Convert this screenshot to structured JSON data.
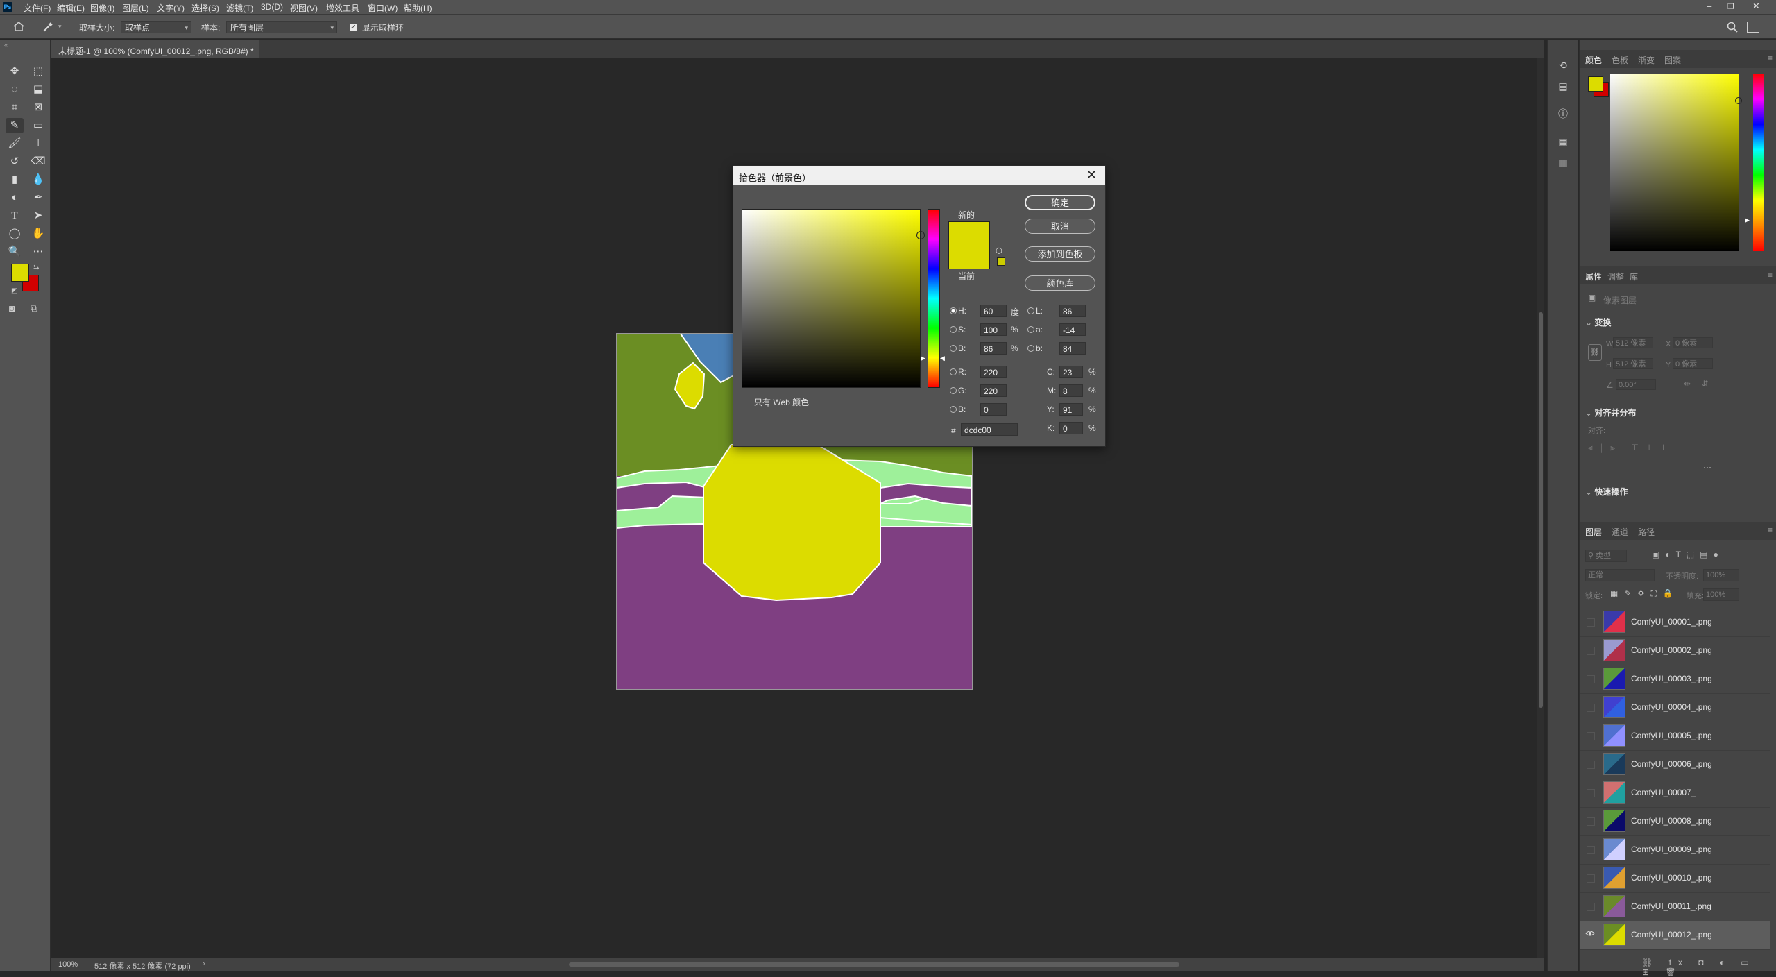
{
  "app": {
    "logo": "Ps"
  },
  "menubar": {
    "items": [
      "文件(F)",
      "编辑(E)",
      "图像(I)",
      "图层(L)",
      "文字(Y)",
      "选择(S)",
      "滤镜(T)",
      "3D(D)",
      "视图(V)",
      "增效工具",
      "窗口(W)",
      "帮助(H)"
    ],
    "win_min": "–",
    "win_restore": "❐",
    "win_close": "✕"
  },
  "options": {
    "sample_size_label": "取样大小:",
    "sample_size_value": "取样点",
    "sample_label": "样本:",
    "sample_value": "所有图层",
    "show_ring_label": "显示取样环",
    "show_ring_checked": true
  },
  "document": {
    "tab_title": "未标题-1 @ 100% (ComfyUI_00012_.png, RGB/8#) *",
    "tab_close": "×",
    "zoom": "100%",
    "status": "512 像素 x 512 像素 (72 ppi)",
    "status_arrow": "›"
  },
  "colors": {
    "foreground": "#dcdc00",
    "background": "#d10000",
    "seg_olive": "#6b8e23",
    "seg_purple": "#7f3f82",
    "seg_mint": "#9ef09a",
    "seg_blue": "#4a7fb5",
    "seg_yellow": "#dcdc00"
  },
  "toolbar": {
    "icons": [
      "move-icon",
      "marquee-icon",
      "lasso-icon",
      "object-select-icon",
      "crop-icon",
      "frame-icon",
      "eyedropper-icon",
      "patch-icon",
      "brush-icon",
      "stamp-icon",
      "history-brush-icon",
      "eraser-icon",
      "gradient-icon",
      "blur-icon",
      "dodge-icon",
      "pen-icon",
      "type-icon",
      "path-select-icon",
      "ellipse-icon",
      "hand-icon",
      "zoom-icon",
      "more-icon"
    ]
  },
  "color_picker": {
    "title": "拾色器（前景色）",
    "close": "✕",
    "new_label": "新的",
    "current_label": "当前",
    "ok": "确定",
    "cancel": "取消",
    "add_swatch": "添加到色板",
    "color_libraries": "颜色库",
    "web_only_label": "只有 Web 颜色",
    "hue_degrees": 60,
    "fields": {
      "H": {
        "label": "H:",
        "value": "60",
        "unit": "度"
      },
      "S": {
        "label": "S:",
        "value": "100",
        "unit": "%"
      },
      "B": {
        "label": "B:",
        "value": "86",
        "unit": "%"
      },
      "R": {
        "label": "R:",
        "value": "220"
      },
      "G": {
        "label": "G:",
        "value": "220"
      },
      "Bl": {
        "label": "B:",
        "value": "0"
      },
      "L": {
        "label": "L:",
        "value": "86"
      },
      "a": {
        "label": "a:",
        "value": "-14"
      },
      "b": {
        "label": "b:",
        "value": "84"
      },
      "C": {
        "label": "C:",
        "value": "23",
        "unit": "%"
      },
      "M": {
        "label": "M:",
        "value": "8",
        "unit": "%"
      },
      "Y": {
        "label": "Y:",
        "value": "91",
        "unit": "%"
      },
      "K": {
        "label": "K:",
        "value": "0",
        "unit": "%"
      }
    },
    "hex_label": "#",
    "hex_value": "dcdc00"
  },
  "color_panel": {
    "tabs": [
      "颜色",
      "色板",
      "渐变",
      "图案"
    ]
  },
  "properties_panel": {
    "tabs": [
      "属性",
      "调整",
      "库"
    ],
    "pixel_layer": "像素图层",
    "transform": "变换",
    "w_label": "W",
    "w_value": "512 像素",
    "h_label": "H",
    "h_value": "512 像素",
    "x_label": "X",
    "x_value": "0 像素",
    "y_label": "Y",
    "y_value": "0 像素",
    "angle_value": "0.00°",
    "align": "对齐并分布",
    "align_sub": "对齐:",
    "quick": "快速操作",
    "more": "···"
  },
  "layers_panel": {
    "tabs": [
      "图层",
      "通道",
      "路径"
    ],
    "search_placeholder": "类型",
    "blend_mode": "正常",
    "opacity_label": "不透明度:",
    "opacity_value": "100%",
    "lock_label": "锁定:",
    "fill_label": "填充:",
    "fill_value": "100%",
    "layers": [
      {
        "name": "ComfyUI_00001_.png",
        "thumb": [
          "#3a3aaa",
          "#e0304a"
        ],
        "visible": false,
        "selected": false
      },
      {
        "name": "ComfyUI_00002_.png",
        "thumb": [
          "#9a9ad0",
          "#b0304a"
        ],
        "visible": false,
        "selected": false
      },
      {
        "name": "ComfyUI_00003_.png",
        "thumb": [
          "#5a9a3a",
          "#1a1ab0"
        ],
        "visible": false,
        "selected": false
      },
      {
        "name": "ComfyUI_00004_.png",
        "thumb": [
          "#4040d0",
          "#3060e0"
        ],
        "visible": false,
        "selected": false
      },
      {
        "name": "ComfyUI_00005_.png",
        "thumb": [
          "#5070d0",
          "#9090ff"
        ],
        "visible": false,
        "selected": false
      },
      {
        "name": "ComfyUI_00006_.png",
        "thumb": [
          "#2a6a8a",
          "#1a3a5a"
        ],
        "visible": false,
        "selected": false
      },
      {
        "name": "ComfyUI_00007_",
        "thumb": [
          "#d07070",
          "#20a0a0"
        ],
        "visible": false,
        "selected": false
      },
      {
        "name": "ComfyUI_00008_.png",
        "thumb": [
          "#5a9a3a",
          "#0a0a6a"
        ],
        "visible": false,
        "selected": false
      },
      {
        "name": "ComfyUI_00009_.png",
        "thumb": [
          "#6a8ad0",
          "#d0d0ff"
        ],
        "visible": false,
        "selected": false
      },
      {
        "name": "ComfyUI_00010_.png",
        "thumb": [
          "#3a5ab0",
          "#e0a030"
        ],
        "visible": false,
        "selected": false
      },
      {
        "name": "ComfyUI_00011_.png",
        "thumb": [
          "#6a8a2a",
          "#8a5a9a"
        ],
        "visible": false,
        "selected": false
      },
      {
        "name": "ComfyUI_00012_.png",
        "thumb": [
          "#6b8e23",
          "#dcdc00"
        ],
        "visible": true,
        "selected": true
      }
    ]
  }
}
